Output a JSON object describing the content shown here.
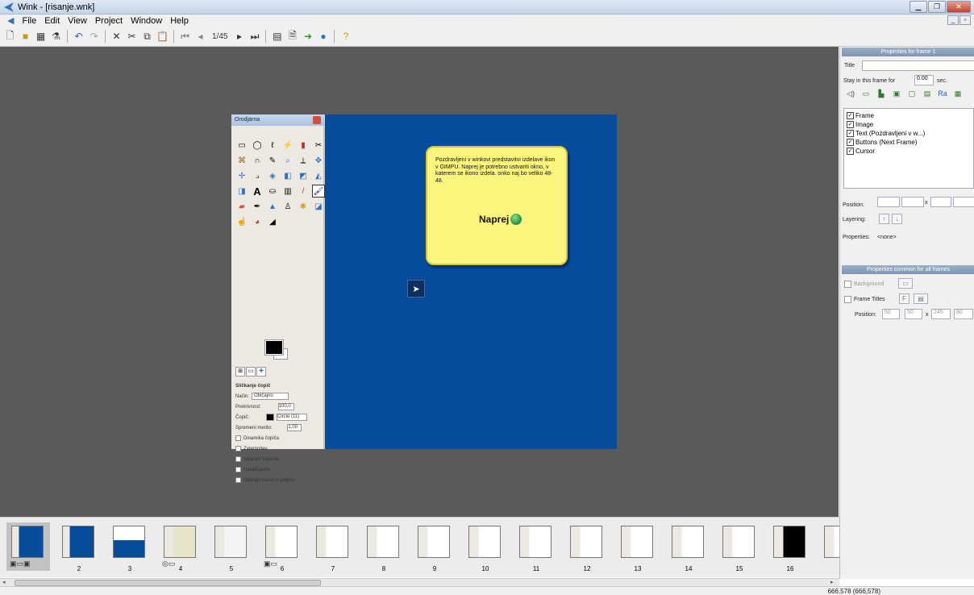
{
  "window": {
    "title": "Wink - [risanje.wnk]"
  },
  "menu": [
    "File",
    "Edit",
    "View",
    "Project",
    "Window",
    "Help"
  ],
  "toolbar": {
    "frame_counter": "1/45"
  },
  "gimp": {
    "title": "Orodjarna",
    "options_title": "Sličkanje čopič",
    "mode_label": "Način:",
    "mode_value": "Običajno",
    "opacity_label": "Prekrivnost:",
    "opacity_value": "100,0",
    "brush_label": "Čopič:",
    "brush_value": "Circle (11)",
    "scale_label": "Spremeni merilo:",
    "scale_value": "1,00",
    "opt1": "Dinamika čopiča",
    "opt2": "Zatemnitev",
    "opt3": "Uporabi trepanje",
    "opt4": "Naraščajoče",
    "opt5": "Uporabi barvo iz prelive"
  },
  "callout": {
    "text": "Pozdravljeni v winkovi predstavitvi izdelave ikon v GIMPU. Naprej je potrebno ustvariti okno, v katerem se ikono izdela. onko naj bo veliko 48-48.",
    "button": "Naprej"
  },
  "props": {
    "header": "Properties for frame 1",
    "title_label": "Title",
    "stay_label": "Stay in this frame for",
    "stay_value": "0.00",
    "stay_unit": "sec.",
    "layers": [
      "Frame",
      "Image",
      "Text (Pozdravljeni v w...)",
      "Buttons (Next Frame)",
      "Cursor"
    ],
    "position_label": "Position:",
    "x_sep": "x",
    "layering_label": "Layering:",
    "properties_label": "Properties:",
    "properties_value": "<none>"
  },
  "common": {
    "header": "Properties common for all frames",
    "background_label": "Background",
    "frame_titles_label": "Frame Titles",
    "font_btn": "F",
    "position_label": "Position:",
    "pos_x": "50",
    "pos_y": "50",
    "x_sep": "x",
    "width": "245",
    "height": "80"
  },
  "filmstrip": {
    "frames": [
      "",
      "2",
      "3",
      "4",
      "5",
      "6",
      "7",
      "8",
      "9",
      "10",
      "11",
      "12",
      "13",
      "14",
      "15",
      "16"
    ]
  },
  "status": {
    "coords": "666,578 (666,578)"
  },
  "colors": {
    "canvas": "#5a5a5a",
    "slide": "#064c9c",
    "callout": "#fdf67e",
    "panel_header": "#8aa0be"
  }
}
